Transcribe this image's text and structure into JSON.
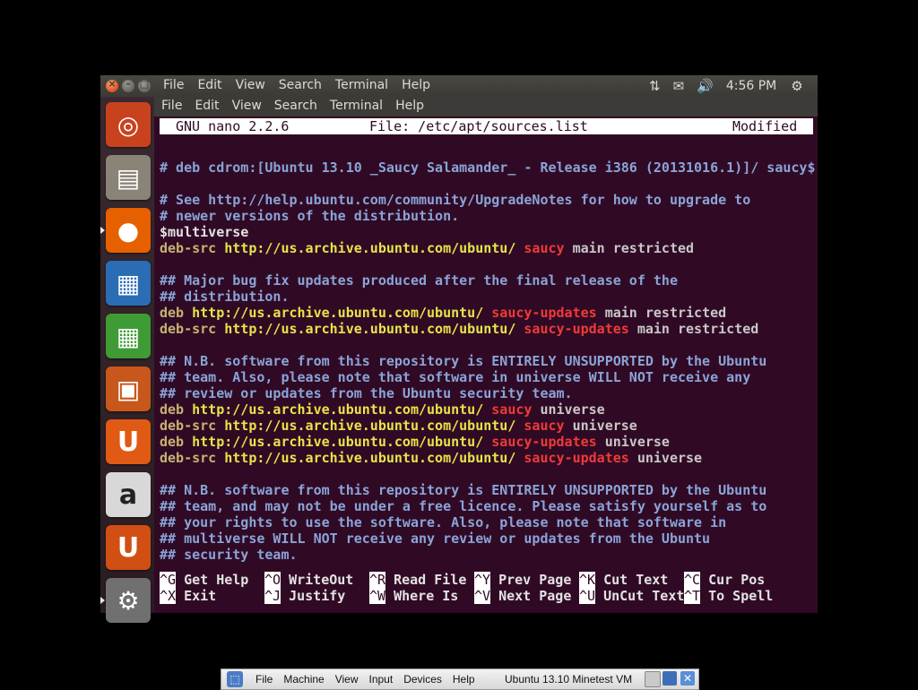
{
  "topbar": {
    "menu": [
      "File",
      "Edit",
      "View",
      "Search",
      "Terminal",
      "Help"
    ],
    "clock": "4:56 PM"
  },
  "terminal_menu": [
    "File",
    "Edit",
    "View",
    "Search",
    "Terminal",
    "Help"
  ],
  "nano": {
    "version": "GNU nano 2.2.6",
    "file": "File: /etc/apt/sources.list",
    "status": "Modified"
  },
  "lines": [
    {
      "row": 2,
      "segs": [
        {
          "c": "cmt",
          "t": "# deb cdrom:[Ubuntu 13.10 _Saucy Salamander_ - Release i386 (20131016.1)]/ saucy$"
        }
      ]
    },
    {
      "row": 4,
      "segs": [
        {
          "c": "cmt",
          "t": "# See http://help.ubuntu.com/community/UpgradeNotes for how to upgrade to"
        }
      ]
    },
    {
      "row": 5,
      "segs": [
        {
          "c": "cmt",
          "t": "# newer versions of the distribution."
        }
      ]
    },
    {
      "row": 6,
      "segs": [
        {
          "c": "plain",
          "t": "$multiverse"
        }
      ]
    },
    {
      "row": 7,
      "segs": [
        {
          "c": "kw",
          "t": "deb-src "
        },
        {
          "c": "url",
          "t": "http://us.archive.ubuntu.com/ubuntu/ "
        },
        {
          "c": "rel",
          "t": "saucy "
        },
        {
          "c": "txt",
          "t": "main restricted"
        }
      ]
    },
    {
      "row": 9,
      "segs": [
        {
          "c": "cmt",
          "t": "## Major bug fix updates produced after the final release of the"
        }
      ]
    },
    {
      "row": 10,
      "segs": [
        {
          "c": "cmt",
          "t": "## distribution."
        }
      ]
    },
    {
      "row": 11,
      "segs": [
        {
          "c": "kw",
          "t": "deb "
        },
        {
          "c": "url",
          "t": "http://us.archive.ubuntu.com/ubuntu/ "
        },
        {
          "c": "rel",
          "t": "saucy-updates "
        },
        {
          "c": "txt",
          "t": "main restricted"
        }
      ]
    },
    {
      "row": 12,
      "segs": [
        {
          "c": "kw",
          "t": "deb-src "
        },
        {
          "c": "url",
          "t": "http://us.archive.ubuntu.com/ubuntu/ "
        },
        {
          "c": "rel",
          "t": "saucy-updates "
        },
        {
          "c": "txt",
          "t": "main restricted"
        }
      ]
    },
    {
      "row": 14,
      "segs": [
        {
          "c": "cmt",
          "t": "## N.B. software from this repository is ENTIRELY UNSUPPORTED by the Ubuntu"
        }
      ]
    },
    {
      "row": 15,
      "segs": [
        {
          "c": "cmt",
          "t": "## team. Also, please note that software in universe WILL NOT receive any"
        }
      ]
    },
    {
      "row": 16,
      "segs": [
        {
          "c": "cmt",
          "t": "## review or updates from the Ubuntu security team."
        }
      ]
    },
    {
      "row": 17,
      "segs": [
        {
          "c": "kw",
          "t": "deb "
        },
        {
          "c": "url",
          "t": "http://us.archive.ubuntu.com/ubuntu/ "
        },
        {
          "c": "rel",
          "t": "saucy "
        },
        {
          "c": "txt",
          "t": "universe"
        }
      ]
    },
    {
      "row": 18,
      "segs": [
        {
          "c": "kw",
          "t": "deb-src "
        },
        {
          "c": "url",
          "t": "http://us.archive.ubuntu.com/ubuntu/ "
        },
        {
          "c": "rel",
          "t": "saucy "
        },
        {
          "c": "txt",
          "t": "universe"
        }
      ]
    },
    {
      "row": 19,
      "segs": [
        {
          "c": "kw",
          "t": "deb "
        },
        {
          "c": "url",
          "t": "http://us.archive.ubuntu.com/ubuntu/ "
        },
        {
          "c": "rel",
          "t": "saucy-updates "
        },
        {
          "c": "txt",
          "t": "universe"
        }
      ]
    },
    {
      "row": 20,
      "segs": [
        {
          "c": "kw",
          "t": "deb-src "
        },
        {
          "c": "url",
          "t": "http://us.archive.ubuntu.com/ubuntu/ "
        },
        {
          "c": "rel",
          "t": "saucy-updates "
        },
        {
          "c": "txt",
          "t": "universe"
        }
      ]
    },
    {
      "row": 22,
      "segs": [
        {
          "c": "cmt",
          "t": "## N.B. software from this repository is ENTIRELY UNSUPPORTED by the Ubuntu"
        }
      ]
    },
    {
      "row": 23,
      "segs": [
        {
          "c": "cmt",
          "t": "## team, and may not be under a free licence. Please satisfy yourself as to"
        }
      ]
    },
    {
      "row": 24,
      "segs": [
        {
          "c": "cmt",
          "t": "## your rights to use the software. Also, please note that software in"
        }
      ]
    },
    {
      "row": 25,
      "segs": [
        {
          "c": "cmt",
          "t": "## multiverse WILL NOT receive any review or updates from the Ubuntu"
        }
      ]
    },
    {
      "row": 26,
      "segs": [
        {
          "c": "cmt",
          "t": "## security team."
        }
      ]
    }
  ],
  "shortcuts": [
    [
      {
        "key": "^G",
        "label": " Get Help"
      },
      {
        "key": "^O",
        "label": " WriteOut"
      },
      {
        "key": "^R",
        "label": " Read File"
      },
      {
        "key": "^Y",
        "label": " Prev Page"
      },
      {
        "key": "^K",
        "label": " Cut Text"
      },
      {
        "key": "^C",
        "label": " Cur Pos"
      }
    ],
    [
      {
        "key": "^X",
        "label": " Exit"
      },
      {
        "key": "^J",
        "label": " Justify"
      },
      {
        "key": "^W",
        "label": " Where Is"
      },
      {
        "key": "^V",
        "label": " Next Page"
      },
      {
        "key": "^U",
        "label": " UnCut Text"
      },
      {
        "key": "^T",
        "label": " To Spell"
      }
    ]
  ],
  "launcher": [
    {
      "name": "ubuntu-dash-icon",
      "color": "#c9421e",
      "glyph": "◎"
    },
    {
      "name": "files-icon",
      "color": "#8a8478",
      "glyph": "▤"
    },
    {
      "name": "firefox-icon",
      "color": "#e66000",
      "glyph": "●"
    },
    {
      "name": "libreoffice-writer-icon",
      "color": "#2a6db5",
      "glyph": "▦"
    },
    {
      "name": "libreoffice-calc-icon",
      "color": "#3f9b35",
      "glyph": "▦"
    },
    {
      "name": "libreoffice-impress-icon",
      "color": "#c8571b",
      "glyph": "▣"
    },
    {
      "name": "ubuntu-software-center-icon",
      "color": "#e05a14",
      "glyph": "U"
    },
    {
      "name": "amazon-icon",
      "color": "#d8d8d8",
      "glyph": "a"
    },
    {
      "name": "ubuntu-one-icon",
      "color": "#d14f13",
      "glyph": "U"
    },
    {
      "name": "system-settings-icon",
      "color": "#707070",
      "glyph": "⚙"
    }
  ],
  "vbox": {
    "menu": [
      "File",
      "Machine",
      "View",
      "Input",
      "Devices",
      "Help"
    ],
    "vm_name": "Ubuntu 13.10 Minetest VM"
  }
}
